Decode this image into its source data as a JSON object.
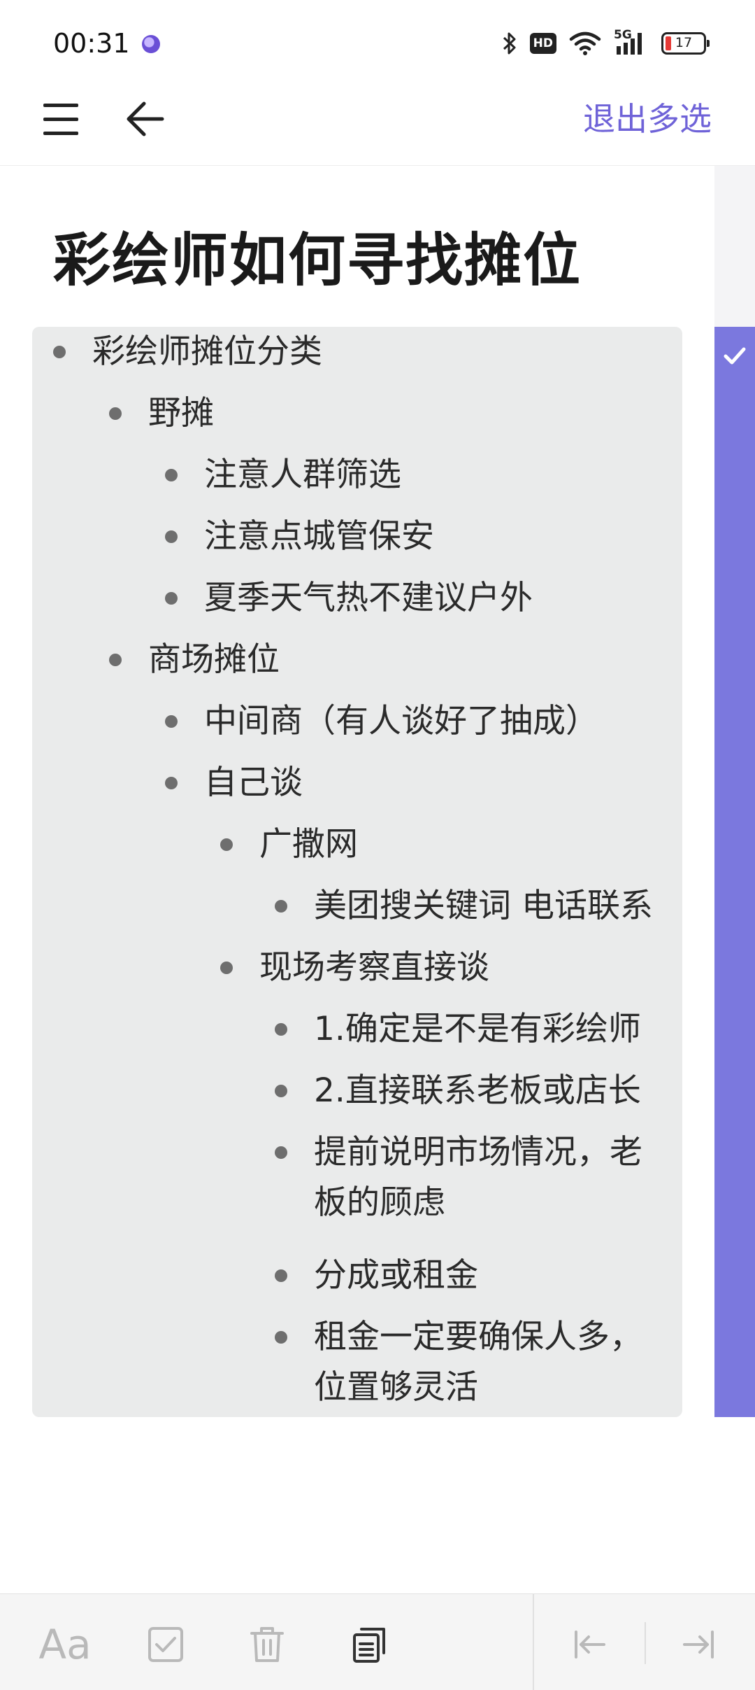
{
  "status_bar": {
    "time": "00:31",
    "battery_level": "17",
    "network": "5G",
    "hd_label": "HD",
    "icons": [
      "app-notification-icon",
      "bluetooth-icon",
      "hd-voice-icon",
      "wifi-icon",
      "signal-5g-icon",
      "battery-icon"
    ]
  },
  "nav": {
    "exit_multiselect_label": "退出多选",
    "icons": [
      "menu-icon",
      "back-arrow-icon"
    ]
  },
  "document": {
    "title": "彩绘师如何寻找摊位",
    "nodes": [
      {
        "text": "彩绘师摊位分类",
        "level": 0
      },
      {
        "text": "野摊",
        "level": 1
      },
      {
        "text": "注意人群筛选",
        "level": 2
      },
      {
        "text": "注意点城管保安",
        "level": 2
      },
      {
        "text": "夏季天气热不建议户外",
        "level": 2
      },
      {
        "text": "商场摊位",
        "level": 1
      },
      {
        "text": "中间商（有人谈好了抽成）",
        "level": 2
      },
      {
        "text": "自己谈",
        "level": 2
      },
      {
        "text": "广撒网",
        "level": 3
      },
      {
        "text": "美团搜关键词 电话联系",
        "level": 4
      },
      {
        "text": "现场考察直接谈",
        "level": 3
      },
      {
        "text": "1.确定是不是有彩绘师",
        "level": 4
      },
      {
        "text": "2.直接联系老板或店长",
        "level": 4
      },
      {
        "text": "提前说明市场情况，老板的顾虑",
        "level": 4
      },
      {
        "text": "分成或租金",
        "level": 4
      },
      {
        "text": "租金一定要确保人多，位置够灵活",
        "level": 4
      }
    ],
    "selected": true
  },
  "toolbar": {
    "font_label": "Aa",
    "icons": [
      "font-style-icon",
      "checkbox-icon",
      "delete-icon",
      "copy-icon",
      "outdent-icon",
      "indent-icon"
    ]
  },
  "colors": {
    "accent": "#6f63d8",
    "selection_strip": "#7b78de",
    "outline_bg": "#eaebeb",
    "battery_low": "#e53935"
  }
}
